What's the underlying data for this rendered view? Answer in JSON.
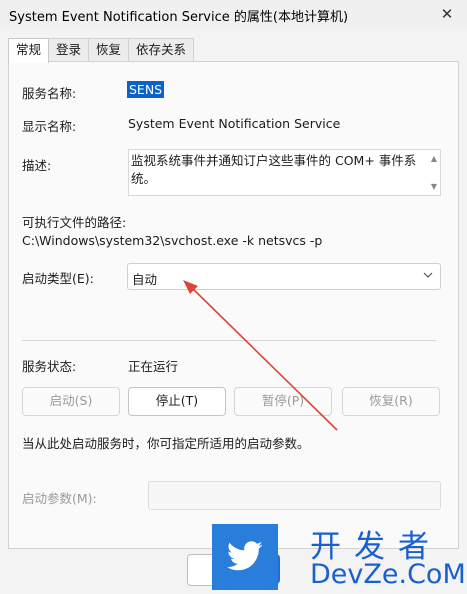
{
  "window": {
    "title": "System Event Notification Service 的属性(本地计算机)",
    "close_glyph": "✕"
  },
  "tabs": [
    {
      "label": "常规"
    },
    {
      "label": "登录"
    },
    {
      "label": "恢复"
    },
    {
      "label": "依存关系"
    }
  ],
  "general": {
    "service_name_label": "服务名称:",
    "service_name": "SENS",
    "display_name_label": "显示名称:",
    "display_name": "System Event Notification Service",
    "description_label": "描述:",
    "description": "监视系统事件并通知订户这些事件的 COM+ 事件系统。",
    "exec_path_label": "可执行文件的路径:",
    "exec_path": "C:\\Windows\\system32\\svchost.exe -k netsvcs -p",
    "startup_type_label": "启动类型(E):",
    "startup_type": "自动",
    "status_label": "服务状态:",
    "status": "正在运行",
    "buttons": {
      "start": "启动(S)",
      "stop": "停止(T)",
      "pause": "暂停(P)",
      "resume": "恢复(R)"
    },
    "hint": "当从此处启动服务时，你可指定所适用的启动参数。",
    "start_params_label": "启动参数(M):",
    "start_params_value": ""
  },
  "watermark": {
    "site_cn": "开发者",
    "site_en": "DevZe.CoM",
    "logo_icon": "twitter-bird-icon"
  },
  "colors": {
    "selection": "#0c63c7",
    "arrow": "#d9473a",
    "watermark": "#1a5fcf"
  }
}
